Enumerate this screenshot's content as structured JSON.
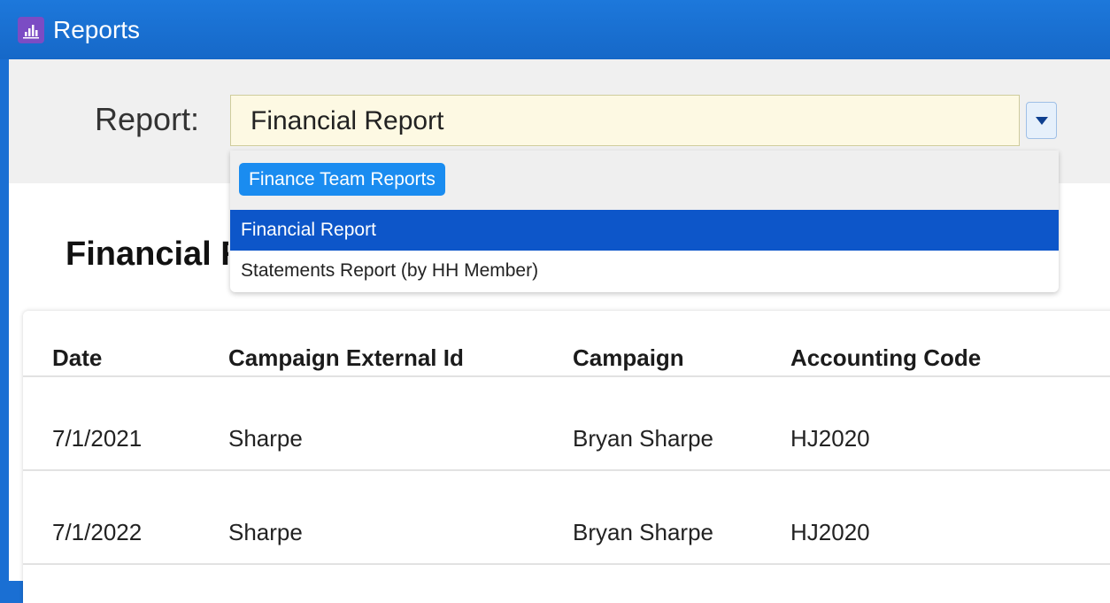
{
  "window": {
    "title": "Reports",
    "icon": "bar-chart-icon"
  },
  "toolbar": {
    "report_label": "Report:",
    "selected_report": "Financial Report",
    "dropdown_icon": "caret-down-icon"
  },
  "dropdown": {
    "group_label": "Finance Team Reports",
    "items": [
      {
        "label": "Financial Report",
        "selected": true
      },
      {
        "label": "Statements Report (by HH Member)",
        "selected": false
      }
    ]
  },
  "page": {
    "heading": "Financial Report"
  },
  "table": {
    "columns": [
      "Date",
      "Campaign External Id",
      "Campaign",
      "Accounting Code"
    ],
    "rows": [
      [
        "7/1/2021",
        "Sharpe",
        "Bryan Sharpe",
        "HJ2020"
      ],
      [
        "7/1/2022",
        "Sharpe",
        "Bryan Sharpe",
        "HJ2020"
      ]
    ]
  },
  "colors": {
    "titlebar": "#1a6fd3",
    "select_bg": "#fdf9e3",
    "selected_item": "#0d56c9",
    "group_chip": "#1a8cf0",
    "app_icon": "#7b4cc4"
  }
}
